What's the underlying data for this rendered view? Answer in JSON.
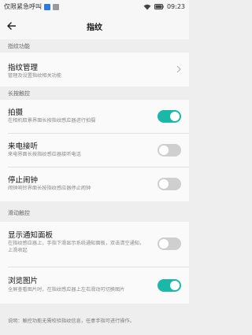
{
  "status_bar": {
    "carrier": "仅限紧急呼叫",
    "time": "09:23",
    "icons": [
      "wifi-icon",
      "battery-icon"
    ]
  },
  "header": {
    "title": "指纹",
    "back_icon": "back-arrow-icon"
  },
  "sections": {
    "fingerprint": "指纹功能",
    "long_press": "长按触控",
    "swipe": "滑动触控"
  },
  "items": {
    "manage": {
      "title": "指纹管理",
      "subtitle": "管理及设置指纹相关功能"
    },
    "photo": {
      "title": "拍摄",
      "subtitle": "在相机取景界面长按指纹感应器进行拍摄",
      "enabled": true
    },
    "answer": {
      "title": "来电接听",
      "subtitle": "来电界面长按指纹感应器接听电话",
      "enabled": false
    },
    "alarm": {
      "title": "停止闹钟",
      "subtitle": "闹钟响铃界面长按指纹感应器停止闹钟",
      "enabled": false
    },
    "notify": {
      "title": "显示通知面板",
      "subtitle": "在指纹感应器上，手指下滑显示系统通知面板，双击清空通知，上滑收起",
      "enabled": false
    },
    "gallery": {
      "title": "浏览图片",
      "subtitle": "全屏查看图片时，在指纹感应器上左右滑动可切换图片",
      "enabled": true
    }
  },
  "footer": {
    "note": "说明：触控功能无需校验指纹信息，任意手指可进行操作。"
  },
  "colors": {
    "toggle_on": "#1ab8a6",
    "toggle_off": "#cfcfcf"
  }
}
